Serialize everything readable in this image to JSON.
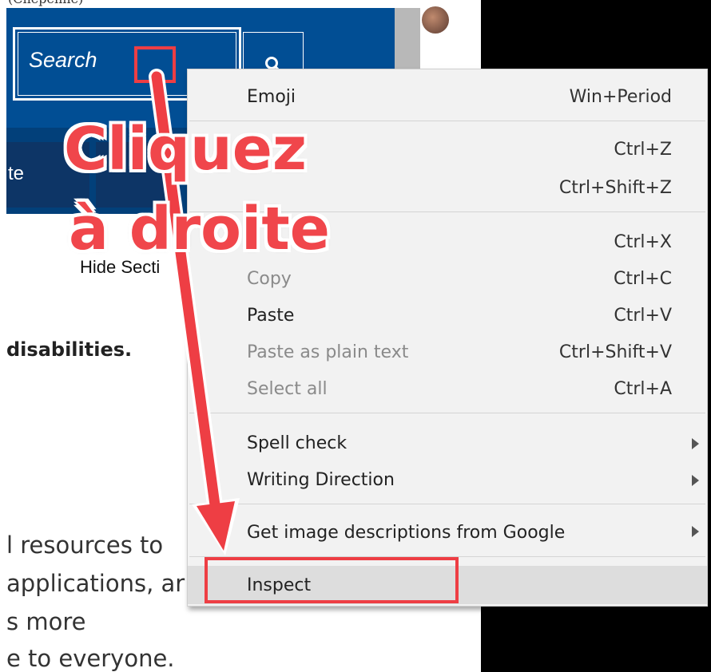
{
  "page": {
    "top_text": "(Chepenne)",
    "search_placeholder": "Search",
    "nav_item": "te",
    "hide_section": "Hide Secti",
    "disabilities": "disabilities.",
    "paragraph": [
      "l resources to",
      "applications, ar",
      "s more",
      "e to everyone."
    ]
  },
  "annotation": {
    "line1": "Cliquez",
    "line2": "à droite",
    "color": "#ee3e44"
  },
  "context_menu": {
    "items": [
      {
        "label": "Emoji",
        "shortcut": "Win+Period",
        "enabled": true
      },
      {
        "label": "",
        "shortcut": "Ctrl+Z",
        "enabled": false
      },
      {
        "label": "",
        "shortcut": "Ctrl+Shift+Z",
        "enabled": false
      },
      {
        "label": "",
        "shortcut": "Ctrl+X",
        "enabled": false
      },
      {
        "label": "Copy",
        "shortcut": "Ctrl+C",
        "enabled": false
      },
      {
        "label": "Paste",
        "shortcut": "Ctrl+V",
        "enabled": true
      },
      {
        "label": "Paste as plain text",
        "shortcut": "Ctrl+Shift+V",
        "enabled": false
      },
      {
        "label": "Select all",
        "shortcut": "Ctrl+A",
        "enabled": false
      },
      {
        "label": "Spell check",
        "submenu": true,
        "enabled": true
      },
      {
        "label": "Writing Direction",
        "submenu": true,
        "enabled": true
      },
      {
        "label": "Get image descriptions from Google",
        "submenu": true,
        "enabled": true
      },
      {
        "label": "Inspect",
        "enabled": true,
        "highlighted": true
      }
    ]
  },
  "colors": {
    "header_blue": "#014e94",
    "nav_blue": "#02407a",
    "menu_bg": "#f2f2f2",
    "menu_highlight": "#dddddd",
    "disabled_text": "#8a8a8a"
  }
}
